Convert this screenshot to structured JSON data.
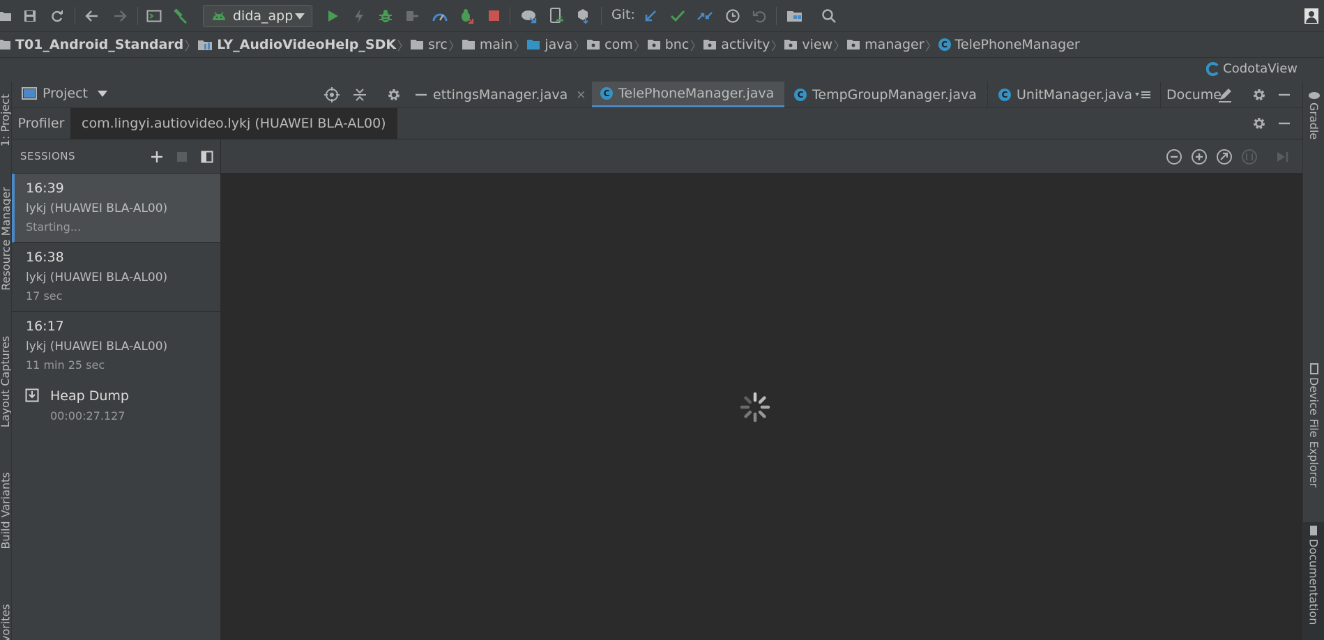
{
  "toolbar": {
    "run_config": "dida_app",
    "git_label": "Git:",
    "icons": [
      "open-folder-icon",
      "save-icon",
      "sync-icon",
      "back-icon",
      "forward-icon",
      "terminal-icon",
      "build-hammer-icon",
      "run-icon",
      "apply-changes-icon",
      "debug-icon",
      "attach-debugger-icon",
      "profile-icon",
      "debug-attach-icon",
      "stop-icon",
      "sync-gradle-icon",
      "avd-manager-icon",
      "sdk-manager-icon",
      "git-update-icon",
      "git-commit-icon",
      "git-merge-icon",
      "history-icon",
      "revert-icon",
      "project-structure-icon",
      "search-icon",
      "user-icon"
    ]
  },
  "breadcrumb": [
    {
      "label": "T01_Android_Standard",
      "icon": "folder-icon",
      "bold": true
    },
    {
      "label": "LY_AudioVideoHelp_SDK",
      "icon": "module-icon",
      "bold": true
    },
    {
      "label": "src",
      "icon": "folder-icon"
    },
    {
      "label": "main",
      "icon": "folder-icon"
    },
    {
      "label": "java",
      "icon": "source-folder-icon"
    },
    {
      "label": "com",
      "icon": "package-icon"
    },
    {
      "label": "bnc",
      "icon": "package-icon"
    },
    {
      "label": "activity",
      "icon": "package-icon"
    },
    {
      "label": "view",
      "icon": "package-icon"
    },
    {
      "label": "manager",
      "icon": "package-icon"
    },
    {
      "label": "TelePhoneManager",
      "icon": "class-icon"
    }
  ],
  "codota": {
    "label": "CodotaView"
  },
  "project_panel": {
    "label": "Project"
  },
  "editor_tabs": [
    {
      "label": "ettingsManager.java",
      "active": false
    },
    {
      "label": "TelePhoneManager.java",
      "active": true
    },
    {
      "label": "TempGroupManager.java",
      "active": false
    },
    {
      "label": "UnitManager.java",
      "active": false
    }
  ],
  "documentation_tab": {
    "label": "Docume"
  },
  "class_icon_letter": "C",
  "close_glyph": "×",
  "left_stripe": [
    "1: Project",
    "Resource Manager",
    "Layout Captures",
    "Build Variants",
    "Favorites"
  ],
  "right_stripe": [
    "Gradle",
    "Device File Explorer",
    "Documentation"
  ],
  "profiler": {
    "tab_label": "Profiler",
    "process": "com.lingyi.autiovideo.lykj (HUAWEI BLA-AL00)",
    "sessions_title": "SESSIONS",
    "sessions": [
      {
        "time": "16:39",
        "device": "lykj (HUAWEI BLA-AL00)",
        "status": "Starting...",
        "selected": true
      },
      {
        "time": "16:38",
        "device": "lykj (HUAWEI BLA-AL00)",
        "status": "17 sec",
        "selected": false
      },
      {
        "time": "16:17",
        "device": "lykj (HUAWEI BLA-AL00)",
        "status": "11 min 25 sec",
        "selected": false
      }
    ],
    "heap_dump": {
      "label": "Heap Dump",
      "time": "00:00:27.127"
    }
  },
  "colors": {
    "background": "#2b2b2b",
    "panel": "#3c3f41",
    "accent": "#4a88c7",
    "run_green": "#499c54",
    "stop_red": "#c75450",
    "class_blue": "#3592c4"
  }
}
